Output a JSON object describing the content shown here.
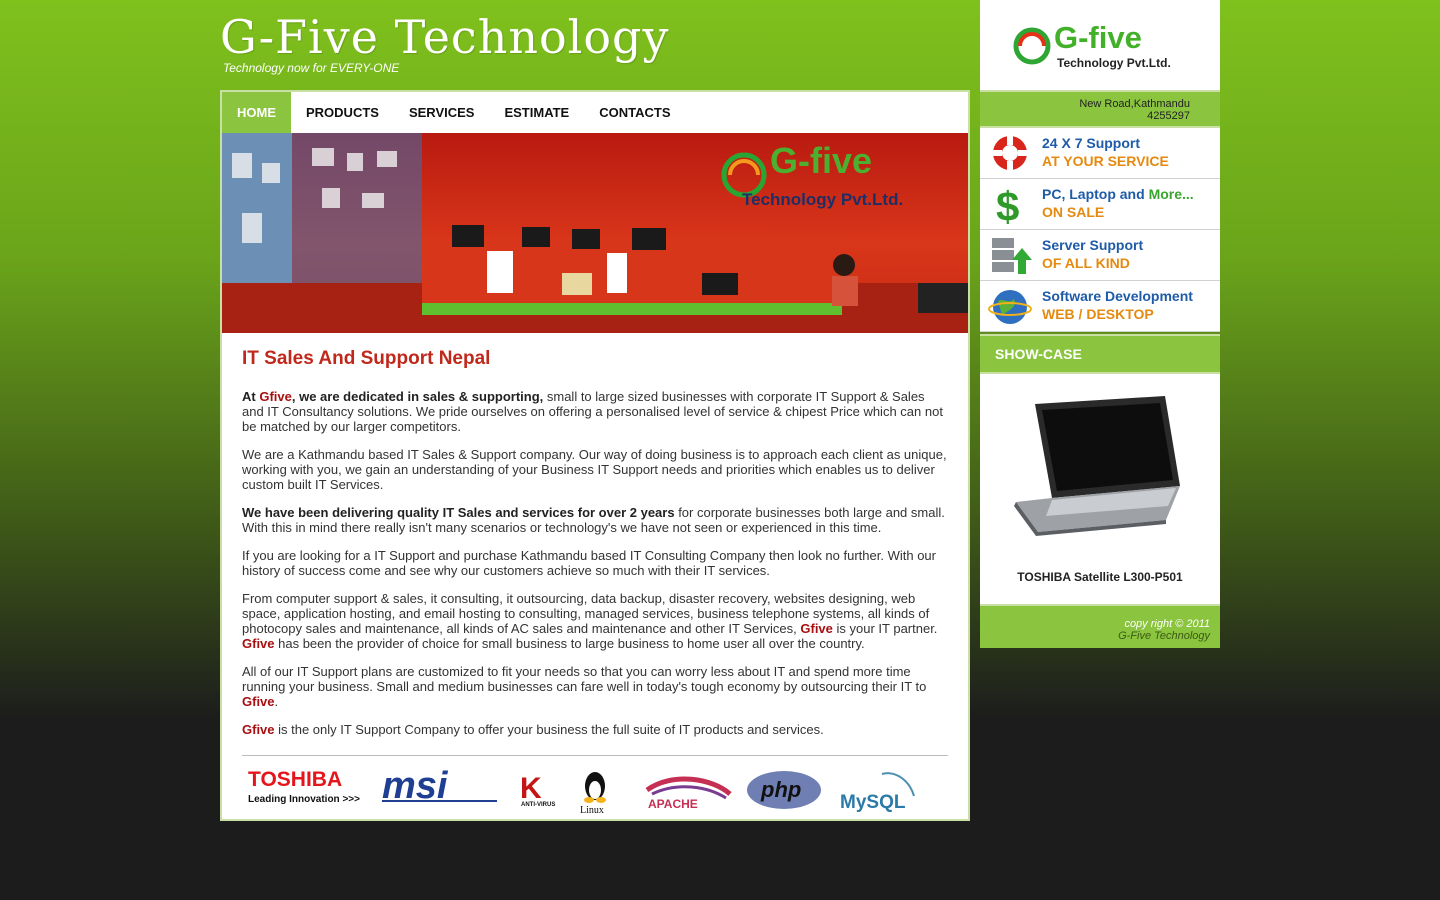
{
  "header": {
    "title": "G-Five Technology",
    "tagline": "Technology now for EVERY-ONE"
  },
  "nav": [
    {
      "label": "HOME",
      "active": true
    },
    {
      "label": "PRODUCTS"
    },
    {
      "label": "SERVICES"
    },
    {
      "label": "ESTIMATE"
    },
    {
      "label": "CONTACTS"
    }
  ],
  "banner": {
    "sign_line1": "G-five",
    "sign_line2": "Technology Pvt.Ltd."
  },
  "content": {
    "heading": "IT Sales And Support Nepal",
    "p1_a": "At ",
    "p1_brand": "Gfive",
    "p1_b": ", we are dedicated in sales & supporting,",
    "p1_c": " small to large sized businesses with corporate IT Support & Sales and IT Consultancy solutions. We pride ourselves on offering a personalised level of service & chipest Price which can not be matched by our larger competitors.",
    "p2": "We are a Kathmandu based IT Sales & Support company. Our way of doing business is to approach each client as unique, working with you, we gain an understanding of your Business IT Support needs and priorities which enables us to deliver custom built IT Services.",
    "p3_bold": "We have been delivering quality IT Sales and services for over 2 years",
    "p3_rest": " for corporate businesses both large and small. With this in mind there really isn't many scenarios or technology's we have not seen or experienced in this time.",
    "p4": "If you are looking for a IT Support and purchase Kathmandu based IT Consulting Company then look no further. With our history of success come and see why our customers achieve so much with their IT services.",
    "p5_a": "From computer support & sales, it consulting, it outsourcing, data backup, disaster recovery, websites designing, web space, application hosting, and email hosting to consulting, managed services, business telephone systems, all kinds of photocopy sales and maintenance, all kinds of AC sales and maintenance and other IT Services, ",
    "p5_brand1": "Gfive",
    "p5_b": " is your IT partner. ",
    "p5_brand2": "Gfive",
    "p5_c": " has been the provider of choice for small business to large business to home user all over the country.",
    "p6_a": "All of our IT Support plans are customized to fit your needs so that you can worry less about IT and spend more time running your business. Small and medium businesses can fare well in today's tough economy by outsourcing their IT to ",
    "p6_brand": "Gfive",
    "p6_b": ".",
    "p7_brand": "Gfive",
    "p7_rest": " is the only IT Support Company to offer your business the full suite of IT products and services."
  },
  "partners": {
    "toshiba": "TOSHIBA",
    "toshiba_sub": "Leading Innovation >>>",
    "msi": "msi",
    "kaspersky": "ANTI-VIRUS",
    "linux": "Linux",
    "apache": "APACHE",
    "php": "php",
    "mysql": "MySQL"
  },
  "sidebar": {
    "logo_name": "G-five",
    "logo_sub": "Technology Pvt.Ltd.",
    "address_line1": "New Road,Kathmandu",
    "address_line2": "4255297",
    "services": [
      {
        "line1": "24 X 7 Support",
        "line2": "AT YOUR SERVICE",
        "icon": "lifebuoy-icon"
      },
      {
        "line1": "PC, Laptop and More...",
        "line2": "ON SALE",
        "icon": "dollar-icon"
      },
      {
        "line1": "Server Support",
        "line2": "OF ALL KIND",
        "icon": "server-icon"
      },
      {
        "line1": "Software Development",
        "line2": "WEB / DESKTOP",
        "icon": "globe-icon"
      }
    ],
    "showcase_title": "SHOW-CASE",
    "product_name": "TOSHIBA Satellite L300-P501",
    "copyright_line1": "copy right © 2011",
    "copyright_line2": "G-Five Technology"
  },
  "colors": {
    "accent_green": "#8bc53f",
    "heading_red": "#c0281b",
    "brand_red": "#a80f10",
    "service_blue": "#1e5ba8",
    "service_orange": "#e58a10"
  }
}
